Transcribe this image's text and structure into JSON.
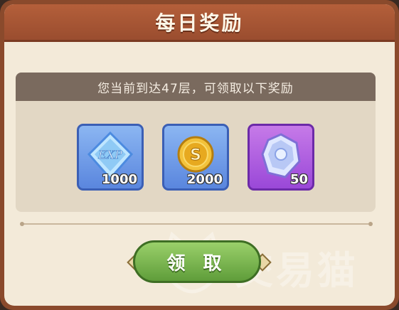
{
  "dialog": {
    "title": "每日奖励",
    "info_text": "您当前到达47层，可领取以下奖励",
    "rewards": [
      {
        "icon": "exp-crystal-icon",
        "count": "1000"
      },
      {
        "icon": "gold-coin-icon",
        "count": "2000"
      },
      {
        "icon": "purple-gem-icon",
        "count": "50"
      }
    ],
    "claim_button_label": "领 取"
  },
  "watermark": {
    "text": "交易猫"
  },
  "colors": {
    "header": "#a6542f",
    "panel_bg": "#f3ead9",
    "info_bar": "#7a6a5e",
    "blue_slot": "#6b97e6",
    "purple_slot": "#b05ee0",
    "claim_button": "#6fae45"
  }
}
